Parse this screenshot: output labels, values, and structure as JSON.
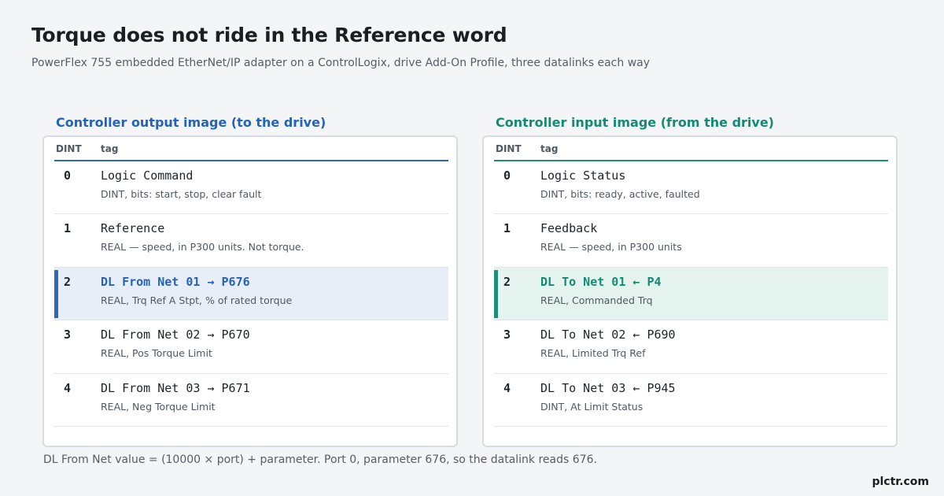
{
  "title": "Torque does not ride in the Reference word",
  "subtitle": "PowerFlex 755 embedded EtherNet/IP adapter on a ControlLogix, drive Add-On Profile, three datalinks each way",
  "columns": {
    "dint": "DINT",
    "tag": "tag"
  },
  "output": {
    "heading": "Controller output image  (to the drive)",
    "accent": "#2f66b8",
    "rows": [
      {
        "num": "0",
        "name": "Logic Command",
        "desc": "DINT, bits: start, stop, clear fault"
      },
      {
        "num": "1",
        "name": "Reference",
        "desc": "REAL — speed, in P300 units. Not torque."
      },
      {
        "num": "2",
        "name": "DL From Net 01 → P676",
        "desc": "REAL, Trq Ref A Stpt, % of rated torque"
      },
      {
        "num": "3",
        "name": "DL From Net 02 → P670",
        "desc": "REAL, Pos Torque Limit"
      },
      {
        "num": "4",
        "name": "DL From Net 03 → P671",
        "desc": "REAL, Neg Torque Limit"
      }
    ]
  },
  "input": {
    "heading": "Controller input image  (from the drive)",
    "accent": "#1f8e78",
    "rows": [
      {
        "num": "0",
        "name": "Logic Status",
        "desc": "DINT, bits: ready, active, faulted"
      },
      {
        "num": "1",
        "name": "Feedback",
        "desc": "REAL — speed, in P300 units"
      },
      {
        "num": "2",
        "name": "DL To Net 01 ← P4",
        "desc": "REAL, Commanded Trq"
      },
      {
        "num": "3",
        "name": "DL To Net 02 ← P690",
        "desc": "REAL, Limited Trq Ref"
      },
      {
        "num": "4",
        "name": "DL To Net 03 ← P945",
        "desc": "DINT, At Limit Status"
      }
    ]
  },
  "footnote": "DL From Net value = (10000 × port) + parameter.  Port 0, parameter 676, so the datalink reads 676.",
  "brand": "plctr.com"
}
